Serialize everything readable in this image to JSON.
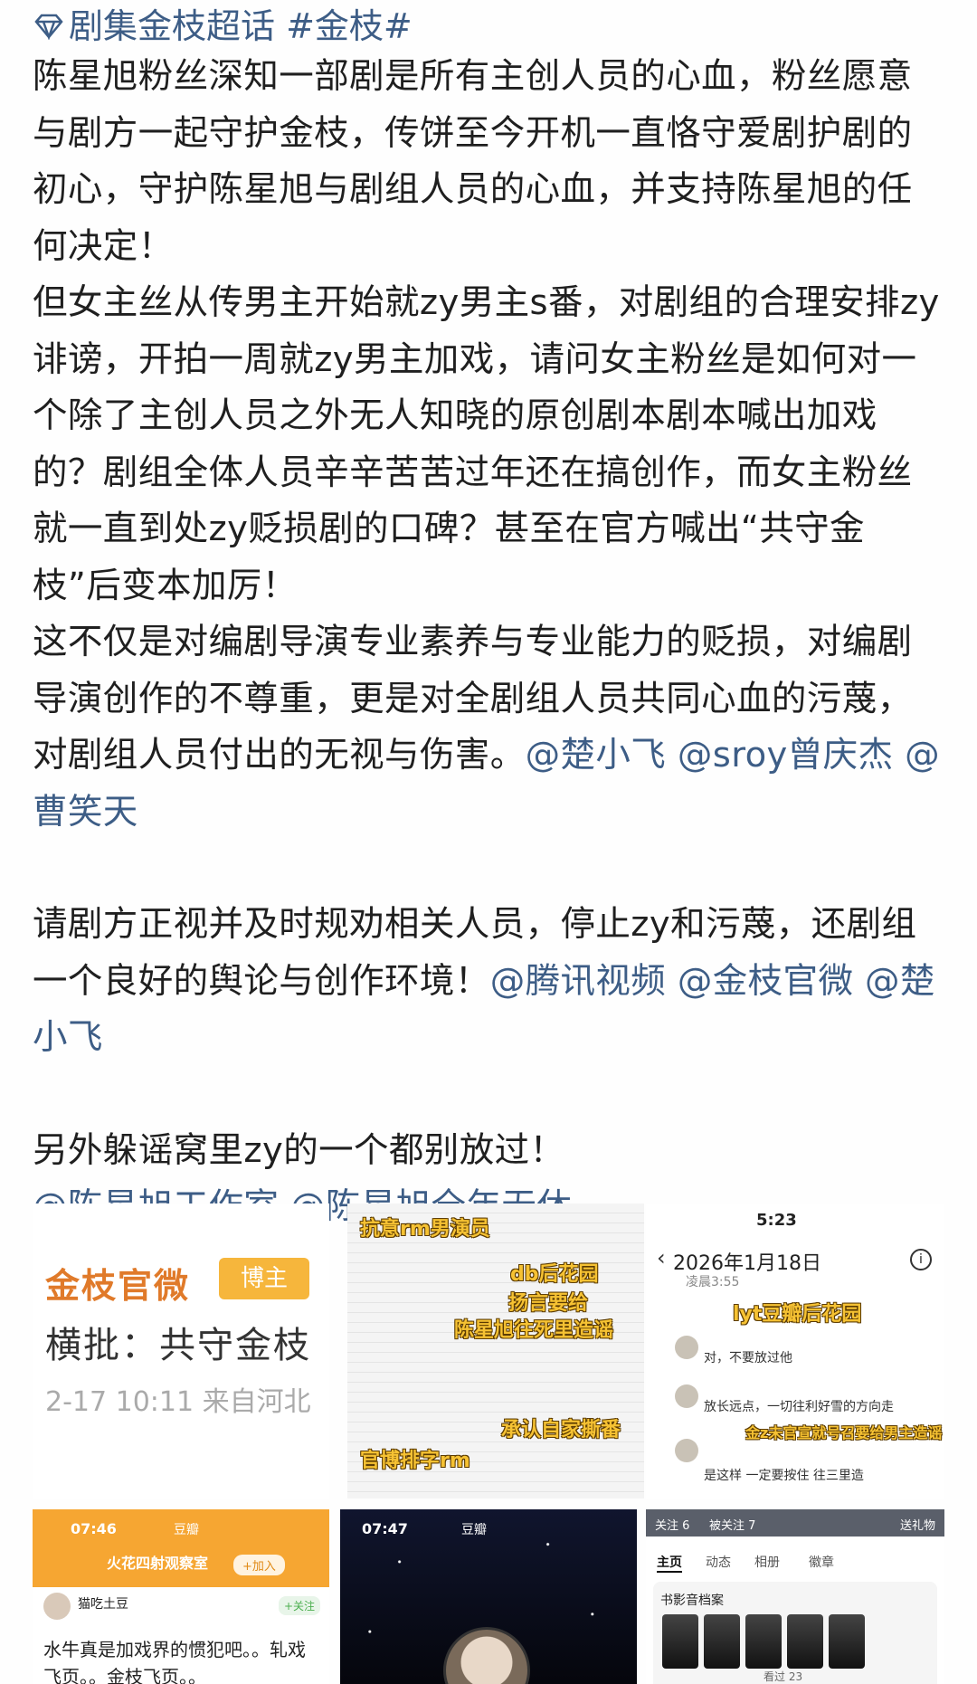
{
  "post": {
    "hashtag": "剧集金枝超话 #金枝#",
    "paragraphs": [
      "陈星旭粉丝深知一部剧是所有主创人员的心血，粉丝愿意与剧方一起守护金枝，传饼至今开机一直恪守爱剧护剧的初心，守护陈星旭与剧组人员的心血，并支持陈星旭的任何决定！",
      "但女主丝从传男主开始就zy男主s番，对剧组的合理安排zy诽谤，开拍一周就zy男主加戏，请问女主粉丝是如何对一个除了主创人员之外无人知晓的原创剧本剧本喊出加戏的？剧组全体人员辛辛苦苦过年还在搞创作，而女主粉丝就一直到处zy贬损剧的口碑？甚至在官方喊出“共守金枝”后变本加厉！"
    ],
    "para3_text": "这不仅是对编剧导演专业素养与专业能力的贬损，对编剧导演创作的不尊重，更是对全剧组人员共同心血的污蔑，对剧组人员付出的无视与伤害。",
    "para3_mentions": "@楚小飞 @sroy曾庆杰 @曹笑天",
    "para4_text": "请剧方正视并及时规劝相关人员，停止zy和污蔑，还剧组一个良好的舆论与创作环境！",
    "para4_mentions": "@腾讯视频 @金枝官微 @楚小飞",
    "para5_text": "另外躲谣窝里zy的一个都别放过！",
    "para5_mentions": "@陈星旭工作室 @陈星旭全年无休"
  },
  "images": {
    "img1": {
      "brand": "金枝官微",
      "badge": "博主",
      "quote": "横批：共守金枝",
      "meta": "2-17 10:11 来自河北"
    },
    "img2": {
      "stickers": [
        "抗意rm男演员",
        "db后花园",
        "扬言要给",
        "陈星旭往死里造谣",
        "承认自家撕番",
        "官博排字rm"
      ]
    },
    "img3": {
      "time": "5:23",
      "date": "2026年1月18日",
      "sub": "凌晨3:55",
      "tag": "lyt豆瓣后花园",
      "row1": "对，不要放过他",
      "row2": "放长远点，一切往利好雪的方向走",
      "row3": "是这样 一定要按住 往三里造",
      "overlay": "金z未官宣就号召要给男主造谣"
    },
    "img4": {
      "time": "07:46",
      "app": "豆瓣",
      "group": "火花四射观察室",
      "join": "+加入",
      "user": "猫吃土豆",
      "follow": "+关注",
      "text": "水牛真是加戏界的惯犯吧。。轧戏飞页。。金枝飞页。。"
    },
    "img5": {
      "time": "07:47",
      "app": "豆瓣"
    },
    "img6": {
      "follow": "关注 6",
      "fans": "被关注 7",
      "gift": "送礼物",
      "tabs": [
        "主页",
        "动态",
        "相册",
        "徽章"
      ],
      "card_title": "书影音档案",
      "seen": "看过 23"
    }
  },
  "colors": {
    "mention": "#3d5d86",
    "text": "#1f1f1f",
    "sticker": "#f6c233"
  }
}
